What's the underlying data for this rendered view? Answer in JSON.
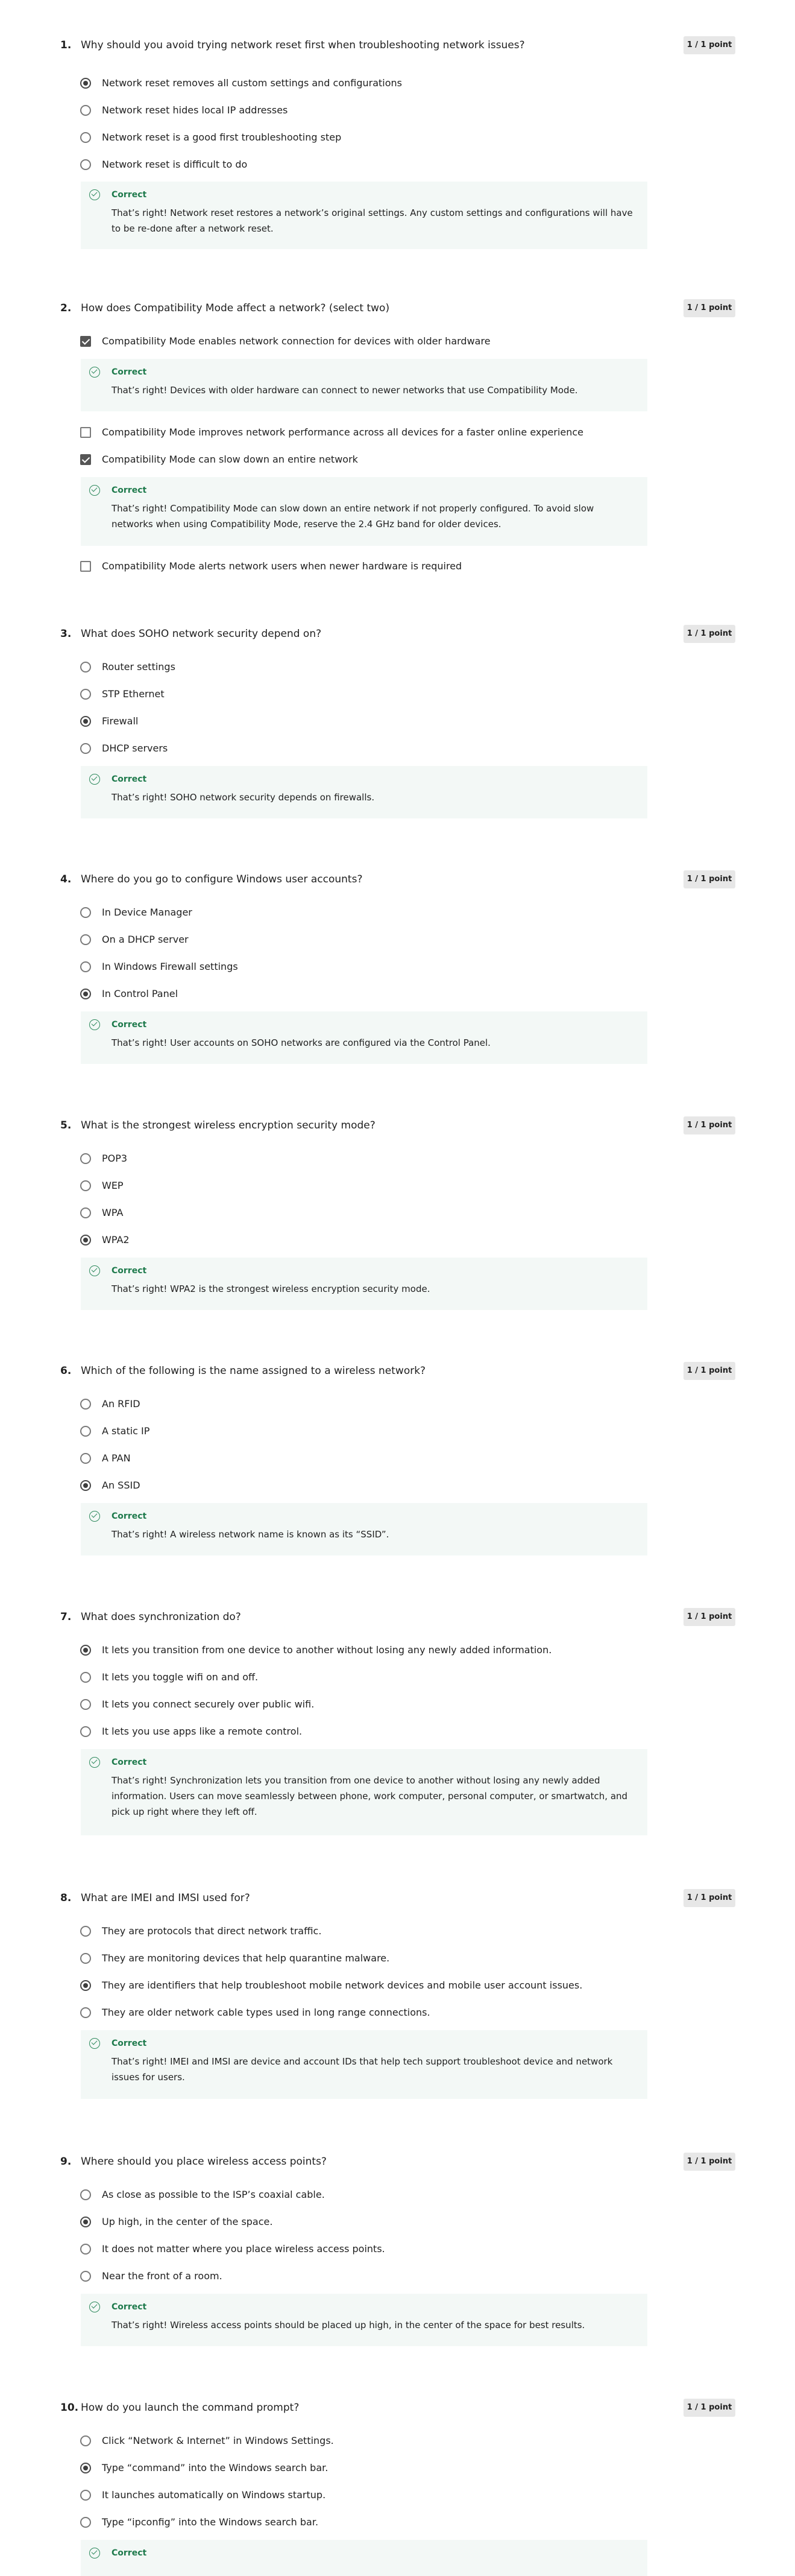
{
  "questions": [
    {
      "number": "1.",
      "text": "Why should you avoid trying network reset first when troubleshooting network issues?",
      "points": "1 / 1 point",
      "type": "radio",
      "options": [
        {
          "label": "Network reset removes all custom settings and configurations",
          "selected": true
        },
        {
          "label": "Network reset hides local IP addresses",
          "selected": false
        },
        {
          "label": "Network reset is a good first troubleshooting step",
          "selected": false
        },
        {
          "label": "Network reset is difficult to do",
          "selected": false
        }
      ],
      "feedback": {
        "title": "Correct",
        "text": "That’s right! Network reset restores a network’s original settings. Any custom settings and configurations will have to be re-done after a network reset."
      }
    },
    {
      "number": "2.",
      "text": "How does Compatibility Mode affect a network? (select two)",
      "points": "1 / 1 point",
      "type": "checkbox",
      "options": [
        {
          "label": "Compatibility Mode enables network connection for devices with older hardware",
          "selected": true,
          "feedback": {
            "title": "Correct",
            "text": "That’s right! Devices with older hardware can connect to newer networks that use Compatibility Mode."
          }
        },
        {
          "label": "Compatibility Mode improves network performance across all devices for a faster online experience",
          "selected": false
        },
        {
          "label": "Compatibility Mode can slow down an entire network",
          "selected": true,
          "feedback": {
            "title": "Correct",
            "text": "That’s right! Compatibility Mode can slow down an entire network if not properly configured. To avoid slow networks when using Compatibility Mode, reserve the 2.4 GHz band for older devices."
          }
        },
        {
          "label": "Compatibility Mode alerts network users when newer hardware is required",
          "selected": false
        }
      ]
    },
    {
      "number": "3.",
      "text": "What does SOHO network security depend on?",
      "points": "1 / 1 point",
      "type": "radio",
      "options": [
        {
          "label": "Router settings",
          "selected": false
        },
        {
          "label": "STP Ethernet",
          "selected": false
        },
        {
          "label": "Firewall",
          "selected": true
        },
        {
          "label": "DHCP servers",
          "selected": false
        }
      ],
      "feedback": {
        "title": "Correct",
        "text": "That’s right! SOHO network security depends on firewalls."
      }
    },
    {
      "number": "4.",
      "text": "Where do you go to configure Windows user accounts?",
      "points": "1 / 1 point",
      "type": "radio",
      "options": [
        {
          "label": "In Device Manager",
          "selected": false
        },
        {
          "label": "On a DHCP server",
          "selected": false
        },
        {
          "label": "In Windows Firewall settings",
          "selected": false
        },
        {
          "label": "In Control Panel",
          "selected": true
        }
      ],
      "feedback": {
        "title": "Correct",
        "text": "That’s right! User accounts on SOHO networks are configured via the Control Panel."
      }
    },
    {
      "number": "5.",
      "text": "What is the strongest wireless encryption security mode?",
      "points": "1 / 1 point",
      "type": "radio",
      "options": [
        {
          "label": "POP3",
          "selected": false
        },
        {
          "label": "WEP",
          "selected": false
        },
        {
          "label": "WPA",
          "selected": false
        },
        {
          "label": "WPA2",
          "selected": true
        }
      ],
      "feedback": {
        "title": "Correct",
        "text": "That’s right! WPA2 is the strongest wireless encryption security mode."
      }
    },
    {
      "number": "6.",
      "text": "Which of the following is the name assigned to a wireless network?",
      "points": "1 / 1 point",
      "type": "radio",
      "options": [
        {
          "label": "An RFID",
          "selected": false
        },
        {
          "label": "A static IP",
          "selected": false
        },
        {
          "label": "A PAN",
          "selected": false
        },
        {
          "label": "An SSID",
          "selected": true
        }
      ],
      "feedback": {
        "title": "Correct",
        "text": "That’s right! A wireless network name is known as its “SSID”."
      }
    },
    {
      "number": "7.",
      "text": "What does synchronization do?",
      "points": "1 / 1 point",
      "type": "radio",
      "options": [
        {
          "label": "It lets you transition from one device to another without losing any newly added information.",
          "selected": true
        },
        {
          "label": "It lets you toggle wifi on and off.",
          "selected": false
        },
        {
          "label": "It lets you connect securely over public wifi.",
          "selected": false
        },
        {
          "label": "It lets you use apps like a remote control.",
          "selected": false
        }
      ],
      "feedback": {
        "title": "Correct",
        "text": "That’s right! Synchronization lets you transition from one device to another without losing any newly added information. Users can move seamlessly between phone, work computer, personal computer, or smartwatch, and pick up right where they left off."
      }
    },
    {
      "number": "8.",
      "text": "What are IMEI and IMSI used for?",
      "points": "1 / 1 point",
      "type": "radio",
      "options": [
        {
          "label": "They are protocols that direct network traffic.",
          "selected": false
        },
        {
          "label": "They are monitoring devices that help quarantine malware.",
          "selected": false
        },
        {
          "label": "They are identifiers that help troubleshoot mobile network devices and mobile user account issues.",
          "selected": true
        },
        {
          "label": "They are older network cable types used in long range connections.",
          "selected": false
        }
      ],
      "feedback": {
        "title": "Correct",
        "text": "That’s right! IMEI and IMSI are device and account IDs that help tech support troubleshoot device and network issues for users."
      }
    },
    {
      "number": "9.",
      "text": "Where should you place wireless access points?",
      "points": "1 / 1 point",
      "type": "radio",
      "options": [
        {
          "label": "As close as possible to the ISP’s coaxial cable.",
          "selected": false
        },
        {
          "label": "Up high, in the center of the space.",
          "selected": true
        },
        {
          "label": "It does not matter where you place wireless access points.",
          "selected": false
        },
        {
          "label": "Near the front of a room.",
          "selected": false
        }
      ],
      "feedback": {
        "title": "Correct",
        "text": "That’s right! Wireless access points should be placed up high, in the center of the space for best results."
      }
    },
    {
      "number": "10.",
      "text": "How do you launch the command prompt?",
      "points": "1 / 1 point",
      "type": "radio",
      "options": [
        {
          "label": "Click “Network & Internet” in Windows Settings.",
          "selected": false
        },
        {
          "label": "Type “command” into the Windows search bar.",
          "selected": true
        },
        {
          "label": "It launches automatically on Windows startup.",
          "selected": false
        },
        {
          "label": "Type “ipconfig” into the Windows search bar.",
          "selected": false
        }
      ],
      "feedback": {
        "title": "Correct",
        "text": ""
      }
    }
  ]
}
